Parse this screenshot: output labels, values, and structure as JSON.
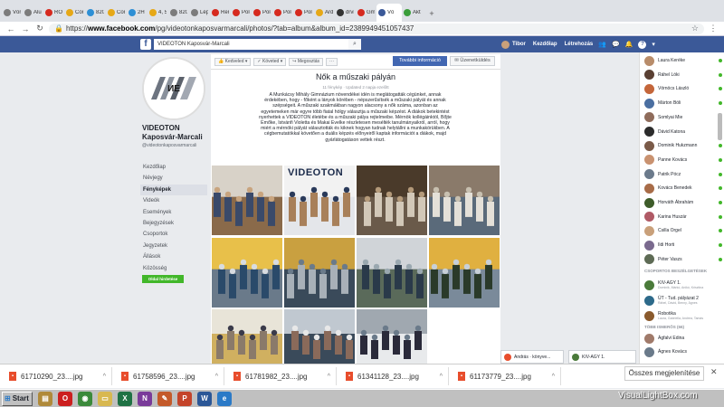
{
  "browser": {
    "tabs": [
      {
        "label": "Vörö",
        "color": "#7c7c7c"
      },
      {
        "label": "Alum",
        "color": "#7c7c7c"
      },
      {
        "label": "ROI",
        "color": "#d62a1f"
      },
      {
        "label": "Con",
        "color": "#e6a817"
      },
      {
        "label": "820",
        "color": "#2d8fd5"
      },
      {
        "label": "Con",
        "color": "#e6a817"
      },
      {
        "label": "2H",
        "color": "#2d8fd5"
      },
      {
        "label": "4, 5",
        "color": "#e6a817"
      },
      {
        "label": "820",
        "color": "#7c7c7c"
      },
      {
        "label": "Lépi",
        "color": "#7c7c7c"
      },
      {
        "label": "Rem",
        "color": "#d62a1f"
      },
      {
        "label": "Polc",
        "color": "#d62a1f"
      },
      {
        "label": "Polc",
        "color": "#d62a1f"
      },
      {
        "label": "Polc",
        "color": "#d62a1f"
      },
      {
        "label": "Polc",
        "color": "#d62a1f"
      },
      {
        "label": "Ardu",
        "color": "#e6a817"
      },
      {
        "label": "drvi",
        "color": "#333333"
      },
      {
        "label": "Gma",
        "color": "#d62a1f"
      },
      {
        "label": "Vö",
        "color": "#3b5998",
        "active": true
      },
      {
        "label": "Aktu",
        "color": "#3b9e3b"
      }
    ],
    "url_prefix": "https://",
    "url_host": "www.facebook.com",
    "url_path": "/pg/videotonkaposvarmarcali/photos/?tab=album&album_id=2389949451057437",
    "back": "←",
    "forward": "→",
    "reload": "↻",
    "star": "☆",
    "menu": "⋮"
  },
  "fb_header": {
    "logo": "f",
    "search_value": "VIDEOTON Kaposvár-Marcali",
    "user": "Tibor",
    "home": "Kezdőlap",
    "create": "Létrehozás",
    "help": "?"
  },
  "page": {
    "logo_text": "ИЕ",
    "name": "VIDEOTON Kaposvár-Marcali",
    "handle": "@videotonkaposvarmarcali",
    "nav": [
      "Kezdőlap",
      "Névjegy",
      "Fényképek",
      "Videók",
      "Események",
      "Bejegyzések",
      "Csoportok",
      "Jegyzetek",
      "Állások",
      "Közösség"
    ],
    "promote": "Oldal hirdetése"
  },
  "actions": {
    "like": "Kedveled",
    "follow": "Követed",
    "share": "Megosztás",
    "more": "···",
    "info": "További információ",
    "message": "Üzenetküldés"
  },
  "album": {
    "title": "Nők a műszaki pályán",
    "meta": "11 fénykép · Updated 2 napja ezelőtt",
    "description": "A Munkácsy Mihály Gimnázium növendékei idén is meglátogatták cégünket, annak érdekében, hogy - főként a lányok körében - népszerűsítsék a műszaki pályát és annak szépségeit. A műszaki szakmákban nagyon alacsony a nők száma, azonban az egyetemeken már egyre több fiatal hölgy választja a műszaki képzést. A diákok betekintést nyerhettek a VIDEOTON életébe és a műszaki pálya rejtelmeibe. Mérnök kollégáinktól, Bőjte Emőke, Istvánfi Violetta és Makai Evelke részletesen mesélték tanulmányaikról, arról, hogy miért a mérnöki pályát választották és kiknek hogyan tudnak helytállni a munkakörükben. A cégbemutatókkal követően a duális képzés előnyeiről kaptak információt a diákok, majd gyárlátogatáson vettek részt.",
    "photo_banner_text": "VIDEOTON"
  },
  "contacts": [
    {
      "name": "Laura Keréke",
      "color": "#b88c6a"
    },
    {
      "name": "Ráhel Lóki",
      "color": "#5a4033"
    },
    {
      "name": "Vörnöcs László",
      "color": "#c4663a"
    },
    {
      "name": "Márton Bóli",
      "color": "#4b6fa1"
    },
    {
      "name": "Somlyai Mie",
      "color": "#8f6c5b"
    },
    {
      "name": "Dávid Katona",
      "color": "#2c2c2c"
    },
    {
      "name": "Dominik Hukzmann",
      "color": "#7a5a48"
    },
    {
      "name": "Panne Kovács",
      "color": "#c99270"
    },
    {
      "name": "Patrik Pócz",
      "color": "#6b7a8b"
    },
    {
      "name": "Kovács Benedek",
      "color": "#a86c48"
    },
    {
      "name": "Horváth Ábrahám",
      "color": "#3e5c2a"
    },
    {
      "name": "Karina Huszár",
      "color": "#b05a66"
    },
    {
      "name": "Csilla Orgel",
      "color": "#c9a07a"
    },
    {
      "name": "Ildi Horti",
      "color": "#7a6a8e"
    },
    {
      "name": "Péter Vaszs",
      "color": "#5e6b55"
    }
  ],
  "groups_header": "CSOPORTOS BESZÉLGETÉSEK",
  "groups": [
    {
      "name": "KIV-AGY 1.",
      "sub": "Dominik, Márkó, Anikó, Krisztina",
      "color": "#4a7a3a"
    },
    {
      "name": "ÚT - Tud. pályázat 2",
      "sub": "Ráhel, Dávid, Benny, Ágnes",
      "color": "#2d6a8a"
    },
    {
      "name": "Robotika",
      "sub": "Laura, Gabriella, Andrea, Tamás",
      "color": "#8a5a2d"
    }
  ],
  "more_contacts_header": "TÖBB ISMERŐS (66)",
  "more_contacts": [
    {
      "name": "Ágfalvi Edina",
      "color": "#a07a6a"
    },
    {
      "name": "Ágnes Kovács",
      "color": "#6a7a8a"
    }
  ],
  "chat_tabs": [
    {
      "label": "András · könyve...",
      "color": "#e84d2c"
    },
    {
      "label": "KIV-AGY 1.",
      "color": "#4a7a3a"
    }
  ],
  "downloads": [
    "61710290_23....jpg",
    "61758596_23....jpg",
    "61781982_23....jpg",
    "61341128_23....jpg",
    "61173779_23....jpg"
  ],
  "downloads_show_all": "Összes megjelenítése",
  "downloads_close": "✕",
  "taskbar": {
    "start": "Start",
    "apps": [
      {
        "name": "files",
        "label": "▤",
        "color": "#b08a3a"
      },
      {
        "name": "opera",
        "label": "O",
        "color": "#cc1f1f"
      },
      {
        "name": "chrome",
        "label": "◉",
        "color": "#3b8a3b"
      },
      {
        "name": "folder",
        "label": "▭",
        "color": "#d8b850"
      },
      {
        "name": "excel",
        "label": "X",
        "color": "#1f7244"
      },
      {
        "name": "onenote",
        "label": "N",
        "color": "#7a3b9a"
      },
      {
        "name": "paint",
        "label": "✎",
        "color": "#c45a2a"
      },
      {
        "name": "powerpoint",
        "label": "P",
        "color": "#c4442a"
      },
      {
        "name": "word",
        "label": "W",
        "color": "#2b5797"
      },
      {
        "name": "ie",
        "label": "e",
        "color": "#2b7ac7"
      }
    ]
  },
  "watermark": "VisualLightBox.com"
}
